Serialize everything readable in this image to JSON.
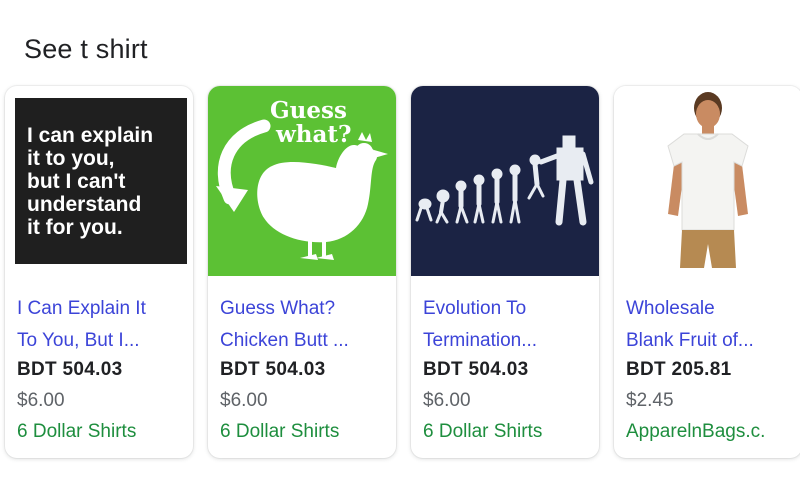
{
  "heading": "See t shirt",
  "products": [
    {
      "image_text": [
        "I can explain",
        "it to you,",
        "but I can't",
        "understand",
        "it for you."
      ],
      "title_line1": "I Can Explain It",
      "title_line2": "To You, But I...",
      "price": "BDT 504.03",
      "original_price": "$6.00",
      "seller": "6 Dollar Shirts",
      "image_bg": "#1f1f1f"
    },
    {
      "image_text": [
        "Guess",
        "what?"
      ],
      "title_line1": "Guess What?",
      "title_line2": "Chicken Butt ...",
      "price": "BDT 504.03",
      "original_price": "$6.00",
      "seller": "6 Dollar Shirts",
      "image_bg": "#5cc134"
    },
    {
      "title_line1": "Evolution To",
      "title_line2": "Termination...",
      "price": "BDT 504.03",
      "original_price": "$6.00",
      "seller": "6 Dollar Shirts",
      "image_bg": "#1b2344"
    },
    {
      "title_line1": "Wholesale",
      "title_line2": "Blank Fruit of...",
      "price": "BDT 205.81",
      "original_price": "$2.45",
      "seller": "ApparelnBags.c.",
      "image_bg": "#ffffff"
    }
  ],
  "colors": {
    "title_link": "#3c44d8",
    "seller_green": "#1e8e3e"
  }
}
